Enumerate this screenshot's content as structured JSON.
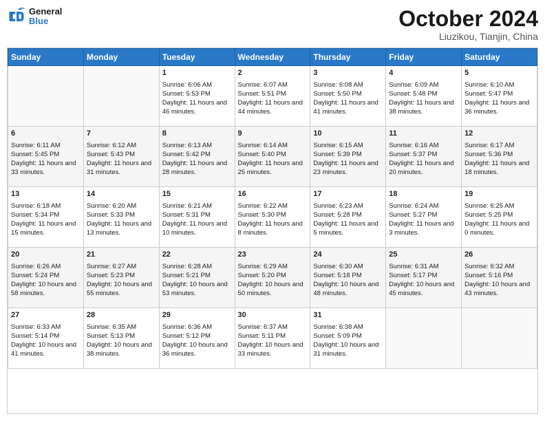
{
  "header": {
    "logo_line1": "General",
    "logo_line2": "Blue",
    "title": "October 2024",
    "subtitle": "Liuzikou, Tianjin, China"
  },
  "days_of_week": [
    "Sunday",
    "Monday",
    "Tuesday",
    "Wednesday",
    "Thursday",
    "Friday",
    "Saturday"
  ],
  "weeks": [
    [
      {
        "day": "",
        "sunrise": "",
        "sunset": "",
        "daylight": ""
      },
      {
        "day": "",
        "sunrise": "",
        "sunset": "",
        "daylight": ""
      },
      {
        "day": "1",
        "sunrise": "Sunrise: 6:06 AM",
        "sunset": "Sunset: 5:53 PM",
        "daylight": "Daylight: 11 hours and 46 minutes."
      },
      {
        "day": "2",
        "sunrise": "Sunrise: 6:07 AM",
        "sunset": "Sunset: 5:51 PM",
        "daylight": "Daylight: 11 hours and 44 minutes."
      },
      {
        "day": "3",
        "sunrise": "Sunrise: 6:08 AM",
        "sunset": "Sunset: 5:50 PM",
        "daylight": "Daylight: 11 hours and 41 minutes."
      },
      {
        "day": "4",
        "sunrise": "Sunrise: 6:09 AM",
        "sunset": "Sunset: 5:48 PM",
        "daylight": "Daylight: 11 hours and 38 minutes."
      },
      {
        "day": "5",
        "sunrise": "Sunrise: 6:10 AM",
        "sunset": "Sunset: 5:47 PM",
        "daylight": "Daylight: 11 hours and 36 minutes."
      }
    ],
    [
      {
        "day": "6",
        "sunrise": "Sunrise: 6:11 AM",
        "sunset": "Sunset: 5:45 PM",
        "daylight": "Daylight: 11 hours and 33 minutes."
      },
      {
        "day": "7",
        "sunrise": "Sunrise: 6:12 AM",
        "sunset": "Sunset: 5:43 PM",
        "daylight": "Daylight: 11 hours and 31 minutes."
      },
      {
        "day": "8",
        "sunrise": "Sunrise: 6:13 AM",
        "sunset": "Sunset: 5:42 PM",
        "daylight": "Daylight: 11 hours and 28 minutes."
      },
      {
        "day": "9",
        "sunrise": "Sunrise: 6:14 AM",
        "sunset": "Sunset: 5:40 PM",
        "daylight": "Daylight: 11 hours and 25 minutes."
      },
      {
        "day": "10",
        "sunrise": "Sunrise: 6:15 AM",
        "sunset": "Sunset: 5:39 PM",
        "daylight": "Daylight: 11 hours and 23 minutes."
      },
      {
        "day": "11",
        "sunrise": "Sunrise: 6:16 AM",
        "sunset": "Sunset: 5:37 PM",
        "daylight": "Daylight: 11 hours and 20 minutes."
      },
      {
        "day": "12",
        "sunrise": "Sunrise: 6:17 AM",
        "sunset": "Sunset: 5:36 PM",
        "daylight": "Daylight: 11 hours and 18 minutes."
      }
    ],
    [
      {
        "day": "13",
        "sunrise": "Sunrise: 6:18 AM",
        "sunset": "Sunset: 5:34 PM",
        "daylight": "Daylight: 11 hours and 15 minutes."
      },
      {
        "day": "14",
        "sunrise": "Sunrise: 6:20 AM",
        "sunset": "Sunset: 5:33 PM",
        "daylight": "Daylight: 11 hours and 13 minutes."
      },
      {
        "day": "15",
        "sunrise": "Sunrise: 6:21 AM",
        "sunset": "Sunset: 5:31 PM",
        "daylight": "Daylight: 11 hours and 10 minutes."
      },
      {
        "day": "16",
        "sunrise": "Sunrise: 6:22 AM",
        "sunset": "Sunset: 5:30 PM",
        "daylight": "Daylight: 11 hours and 8 minutes."
      },
      {
        "day": "17",
        "sunrise": "Sunrise: 6:23 AM",
        "sunset": "Sunset: 5:28 PM",
        "daylight": "Daylight: 11 hours and 5 minutes."
      },
      {
        "day": "18",
        "sunrise": "Sunrise: 6:24 AM",
        "sunset": "Sunset: 5:27 PM",
        "daylight": "Daylight: 11 hours and 3 minutes."
      },
      {
        "day": "19",
        "sunrise": "Sunrise: 6:25 AM",
        "sunset": "Sunset: 5:25 PM",
        "daylight": "Daylight: 11 hours and 0 minutes."
      }
    ],
    [
      {
        "day": "20",
        "sunrise": "Sunrise: 6:26 AM",
        "sunset": "Sunset: 5:24 PM",
        "daylight": "Daylight: 10 hours and 58 minutes."
      },
      {
        "day": "21",
        "sunrise": "Sunrise: 6:27 AM",
        "sunset": "Sunset: 5:23 PM",
        "daylight": "Daylight: 10 hours and 55 minutes."
      },
      {
        "day": "22",
        "sunrise": "Sunrise: 6:28 AM",
        "sunset": "Sunset: 5:21 PM",
        "daylight": "Daylight: 10 hours and 53 minutes."
      },
      {
        "day": "23",
        "sunrise": "Sunrise: 6:29 AM",
        "sunset": "Sunset: 5:20 PM",
        "daylight": "Daylight: 10 hours and 50 minutes."
      },
      {
        "day": "24",
        "sunrise": "Sunrise: 6:30 AM",
        "sunset": "Sunset: 5:18 PM",
        "daylight": "Daylight: 10 hours and 48 minutes."
      },
      {
        "day": "25",
        "sunrise": "Sunrise: 6:31 AM",
        "sunset": "Sunset: 5:17 PM",
        "daylight": "Daylight: 10 hours and 45 minutes."
      },
      {
        "day": "26",
        "sunrise": "Sunrise: 6:32 AM",
        "sunset": "Sunset: 5:16 PM",
        "daylight": "Daylight: 10 hours and 43 minutes."
      }
    ],
    [
      {
        "day": "27",
        "sunrise": "Sunrise: 6:33 AM",
        "sunset": "Sunset: 5:14 PM",
        "daylight": "Daylight: 10 hours and 41 minutes."
      },
      {
        "day": "28",
        "sunrise": "Sunrise: 6:35 AM",
        "sunset": "Sunset: 5:13 PM",
        "daylight": "Daylight: 10 hours and 38 minutes."
      },
      {
        "day": "29",
        "sunrise": "Sunrise: 6:36 AM",
        "sunset": "Sunset: 5:12 PM",
        "daylight": "Daylight: 10 hours and 36 minutes."
      },
      {
        "day": "30",
        "sunrise": "Sunrise: 6:37 AM",
        "sunset": "Sunset: 5:11 PM",
        "daylight": "Daylight: 10 hours and 33 minutes."
      },
      {
        "day": "31",
        "sunrise": "Sunrise: 6:38 AM",
        "sunset": "Sunset: 5:09 PM",
        "daylight": "Daylight: 10 hours and 31 minutes."
      },
      {
        "day": "",
        "sunrise": "",
        "sunset": "",
        "daylight": ""
      },
      {
        "day": "",
        "sunrise": "",
        "sunset": "",
        "daylight": ""
      }
    ]
  ]
}
